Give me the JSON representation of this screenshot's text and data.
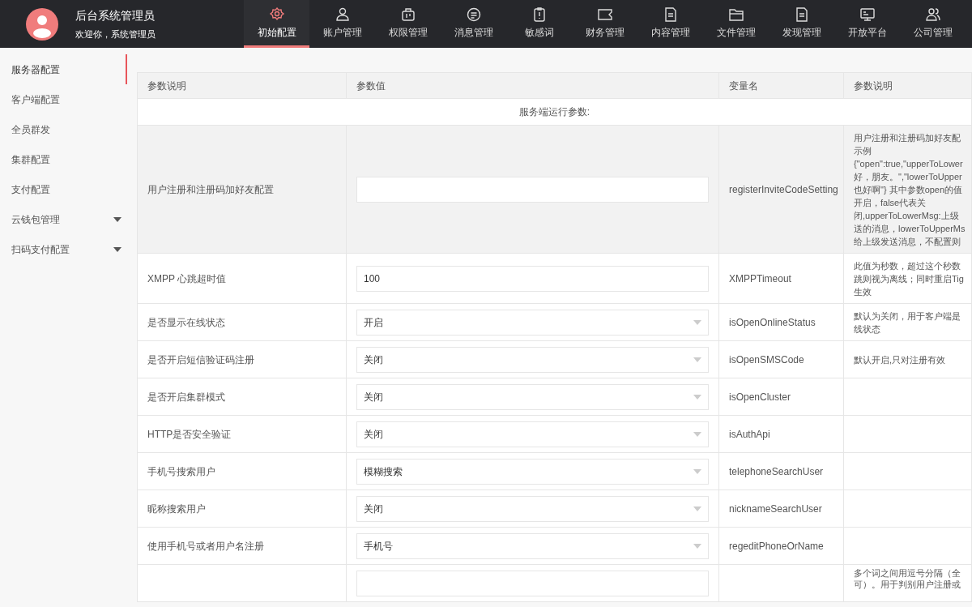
{
  "header": {
    "title": "后台系统管理员",
    "welcome": "欢迎你，系统管理员"
  },
  "nav": [
    {
      "label": "初始配置",
      "selected": true
    },
    {
      "label": "账户管理",
      "selected": false
    },
    {
      "label": "权限管理",
      "selected": false
    },
    {
      "label": "消息管理",
      "selected": false
    },
    {
      "label": "敏感词",
      "selected": false
    },
    {
      "label": "财务管理",
      "selected": false
    },
    {
      "label": "内容管理",
      "selected": false
    },
    {
      "label": "文件管理",
      "selected": false
    },
    {
      "label": "发现管理",
      "selected": false
    },
    {
      "label": "开放平台",
      "selected": false
    },
    {
      "label": "公司管理",
      "selected": false
    }
  ],
  "sidebar": {
    "items": [
      {
        "label": "服务器配置",
        "selected": true,
        "expandable": false
      },
      {
        "label": "客户端配置",
        "selected": false,
        "expandable": false
      },
      {
        "label": "全员群发",
        "selected": false,
        "expandable": false
      },
      {
        "label": "集群配置",
        "selected": false,
        "expandable": false
      },
      {
        "label": "支付配置",
        "selected": false,
        "expandable": false
      },
      {
        "label": "云钱包管理",
        "selected": false,
        "expandable": true
      },
      {
        "label": "扫码支付配置",
        "selected": false,
        "expandable": true
      }
    ]
  },
  "table": {
    "columns": [
      "参数说明",
      "参数值",
      "变量名",
      "参数说明"
    ],
    "section": "服务端运行参数:",
    "rows": [
      {
        "label": "用户注册和注册码加好友配置",
        "kind": "input",
        "value": "",
        "variable": "registerInviteCodeSetting",
        "highlighted": true,
        "description": [
          "用户注册和注册码加好友配",
          "示例",
          "{\"open\":true,\"upperToLower",
          "好，朋友。\",\"lowerToUpper",
          "也好啊\"} 其中参数open的值",
          "开启，false代表关",
          "闭,upperToLowerMsg:上级",
          "送的消息，lowerToUpperMs",
          "给上级发送消息，不配置则"
        ]
      },
      {
        "label": "XMPP 心跳超时值",
        "kind": "input",
        "value": "100",
        "variable": "XMPPTimeout",
        "highlighted": false,
        "description": [
          "此值为秒数，超过这个秒数",
          "跳则视为离线；同时重启Tig",
          "生效"
        ]
      },
      {
        "label": "是否显示在线状态",
        "kind": "select",
        "value": "开启",
        "variable": "isOpenOnlineStatus",
        "highlighted": false,
        "description": [
          "默认为关闭，用于客户端是",
          "线状态"
        ]
      },
      {
        "label": "是否开启短信验证码注册",
        "kind": "select",
        "value": "关闭",
        "variable": "isOpenSMSCode",
        "highlighted": false,
        "description": [
          "默认开启,只对注册有效"
        ]
      },
      {
        "label": "是否开启集群模式",
        "kind": "select",
        "value": "关闭",
        "variable": "isOpenCluster",
        "highlighted": false,
        "description": []
      },
      {
        "label": "HTTP是否安全验证",
        "kind": "select",
        "value": "关闭",
        "variable": "isAuthApi",
        "highlighted": false,
        "description": []
      },
      {
        "label": "手机号搜索用户",
        "kind": "select",
        "value": "模糊搜索",
        "variable": "telephoneSearchUser",
        "highlighted": false,
        "description": []
      },
      {
        "label": "昵称搜索用户",
        "kind": "select",
        "value": "关闭",
        "variable": "nicknameSearchUser",
        "highlighted": false,
        "description": []
      },
      {
        "label": "使用手机号或者用户名注册",
        "kind": "select",
        "value": "手机号",
        "variable": "regeditPhoneOrName",
        "highlighted": false,
        "description": []
      },
      {
        "kind": "input",
        "value": "",
        "highlighted": false,
        "description": [
          "多个词之间用逗号分隔（全",
          "可）。用于判别用户注册或"
        ]
      }
    ]
  }
}
